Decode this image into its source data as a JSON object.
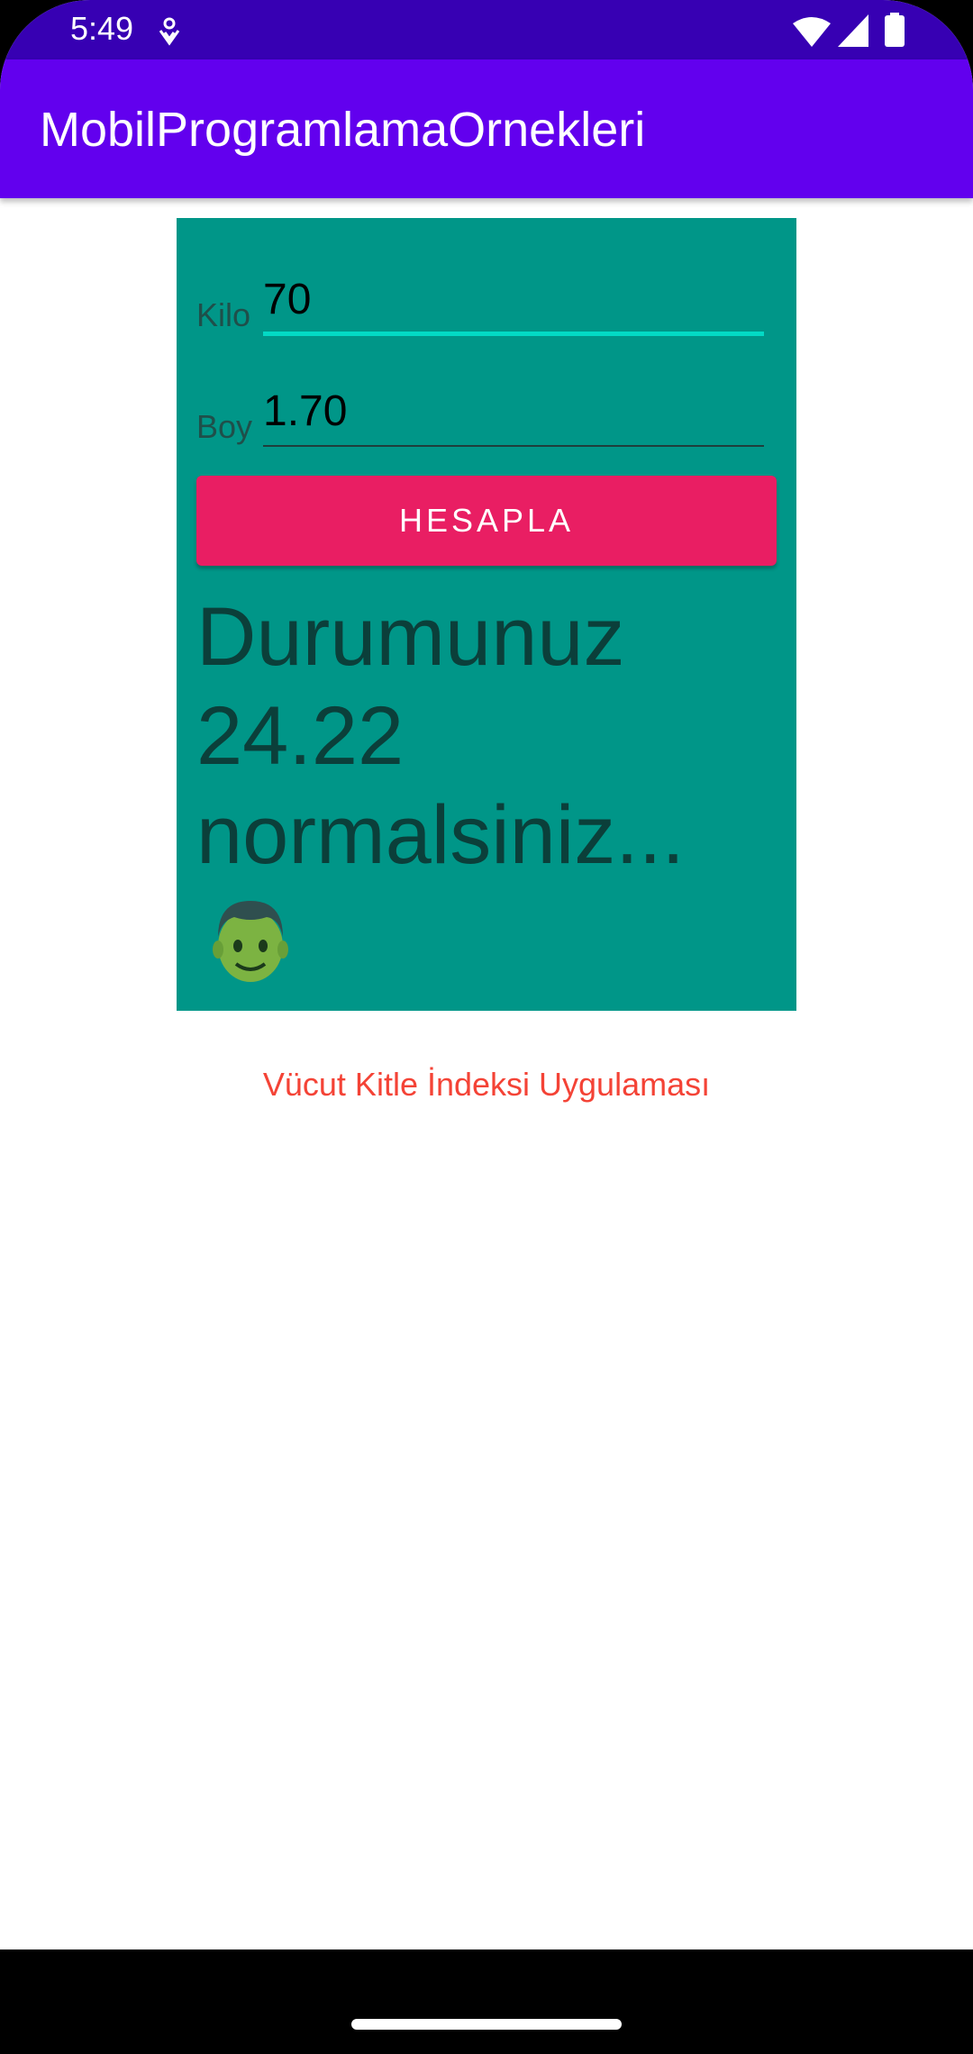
{
  "status_bar": {
    "time": "5:49"
  },
  "app_bar": {
    "title": "MobilProgramlamaOrnekleri"
  },
  "form": {
    "kilo_label": "Kilo",
    "kilo_value": "70",
    "boy_label": "Boy",
    "boy_value": "1.70",
    "calculate_label": "HESAPLA"
  },
  "result": {
    "text": "Durumunuz\n24.22\nnormalsiniz...",
    "emoji": "man-face-emoji"
  },
  "footer": {
    "caption": "Vücut Kitle İndeksi Uygulaması"
  },
  "colors": {
    "status_bar": "#3700b3",
    "app_bar": "#6200ee",
    "panel": "#009688",
    "button": "#e91e63",
    "accent_underline": "#03dac5",
    "caption": "#f44336"
  }
}
